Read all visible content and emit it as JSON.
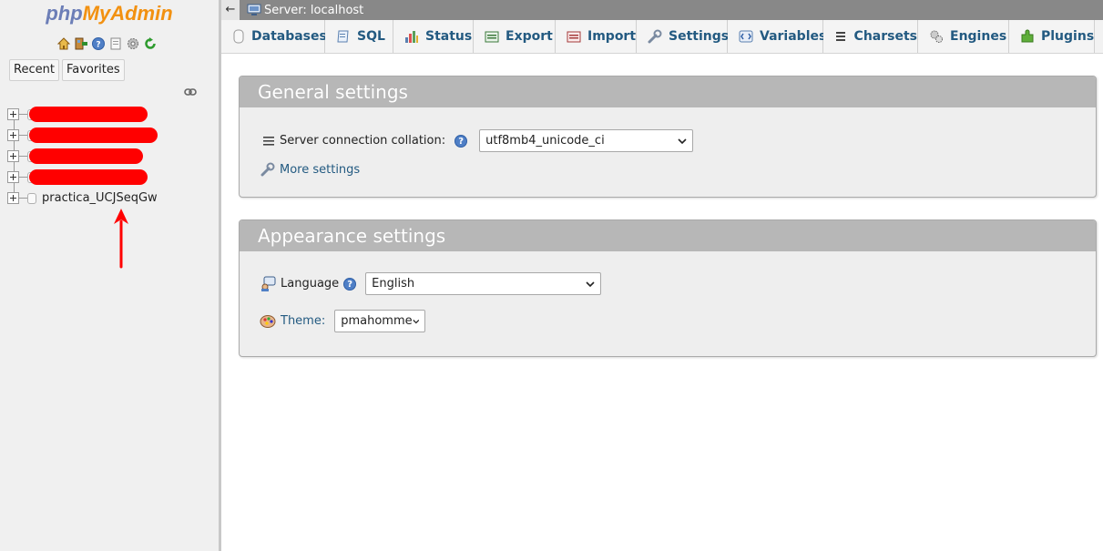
{
  "app": {
    "logo_php": "php",
    "logo_myadmin": "MyAdmin"
  },
  "nav": {
    "tabs": [
      "Recent",
      "Favorites"
    ],
    "icons": [
      "home-icon",
      "logout-icon",
      "help-icon",
      "docs-icon",
      "settings-gear-icon",
      "reload-icon"
    ],
    "databases": [
      {
        "label": "",
        "redacted": true
      },
      {
        "label": "",
        "redacted": true
      },
      {
        "label": "",
        "redacted": true
      },
      {
        "label": "",
        "redacted": true
      },
      {
        "label": "practica_UCJSeqGw",
        "redacted": false
      }
    ],
    "annotation_color": "#ff0000"
  },
  "topbar": {
    "collapse": "←",
    "server": "Server: localhost"
  },
  "tabs": [
    {
      "label": "Databases",
      "icon": "database-icon"
    },
    {
      "label": "SQL",
      "icon": "sql-icon"
    },
    {
      "label": "Status",
      "icon": "status-chart-icon"
    },
    {
      "label": "Export",
      "icon": "export-icon"
    },
    {
      "label": "Import",
      "icon": "import-icon"
    },
    {
      "label": "Settings",
      "icon": "wrench-icon"
    },
    {
      "label": "Variables",
      "icon": "variables-icon"
    },
    {
      "label": "Charsets",
      "icon": "charsets-icon"
    },
    {
      "label": "Engines",
      "icon": "engines-icon"
    },
    {
      "label": "Plugins",
      "icon": "plugin-icon"
    }
  ],
  "general": {
    "title": "General settings",
    "collation_label": "Server connection collation:",
    "collation_value": "utf8mb4_unicode_ci",
    "more_settings": "More settings"
  },
  "appearance": {
    "title": "Appearance settings",
    "language_label": "Language",
    "language_value": "English",
    "theme_label": "Theme:",
    "theme_value": "pmahomme"
  },
  "colors": {
    "link": "#235a81",
    "legend_bg": "#b7b7b7",
    "topbar_bg": "#888888",
    "logo_php": "#6c7eb7",
    "logo_myadmin": "#f29111"
  }
}
